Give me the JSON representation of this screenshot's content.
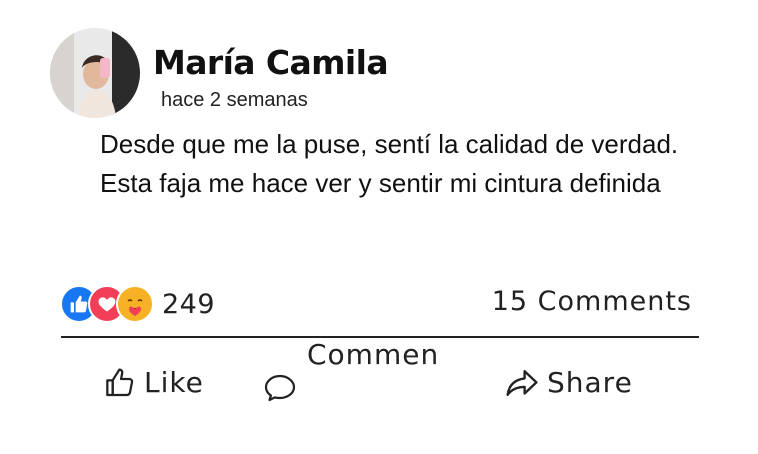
{
  "post": {
    "author_name": "María Camila",
    "timestamp": "hace 2 semanas",
    "text": "Desde que me la puse, sentí la calidad de verdad. Esta faja me hace ver y sentir mi cintura definida"
  },
  "reactions": {
    "icons": [
      "like-icon",
      "love-icon",
      "care-icon"
    ],
    "colors": {
      "like": "#1877F2",
      "love": "#F33E58",
      "care": "#F7B125"
    },
    "count": "249"
  },
  "comments": {
    "count_label": "15 Comments"
  },
  "actions": {
    "like_label": "Like",
    "comment_label": "Commen",
    "share_label": "Share"
  }
}
